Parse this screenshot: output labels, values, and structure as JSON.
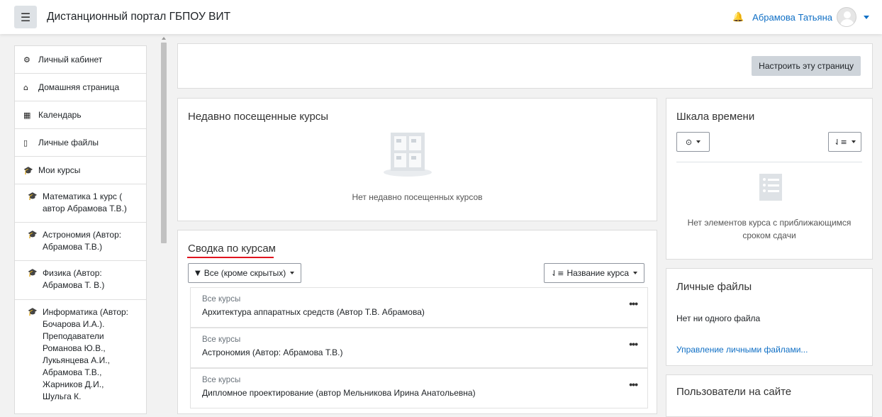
{
  "header": {
    "menu_icon": "hamburger-icon",
    "site_title": "Дистанционный портал ГБПОУ ВИТ",
    "username": "Абрамова Татьяна"
  },
  "sidebar": {
    "items": [
      {
        "icon": "dashboard-icon",
        "label": "Личный кабинет"
      },
      {
        "icon": "home-icon",
        "label": "Домашняя страница"
      },
      {
        "icon": "calendar-icon",
        "label": "Календарь"
      },
      {
        "icon": "file-icon",
        "label": "Личные файлы"
      },
      {
        "icon": "graduation-cap-icon",
        "label": "Мои курсы"
      }
    ],
    "courses": [
      "Математика 1 курс (\nавтор Абрамова Т.В.)",
      "Астрономия (Автор:\nАбрамова Т.В.)",
      "Физика (Автор:\nАбрамова Т. В.)",
      "Информатика (Автор:\nБочарова И.А.).\nПреподаватели\nРоманова Ю.В.,\nЛукьянцева А.И.,\nАбрамова Т.В.,\nЖарников Д.И.,\nШульга К."
    ]
  },
  "page": {
    "customize_button": "Настроить эту страницу"
  },
  "recent_courses": {
    "title": "Недавно посещенные курсы",
    "empty_text": "Нет недавно посещенных курсов"
  },
  "course_overview": {
    "title": "Сводка по курсам",
    "filter_label": "Все (кроме скрытых)",
    "sort_label": "Название курса",
    "courses": [
      {
        "category": "Все курсы",
        "name": "Архитектура аппаратных средств (Автор Т.В. Абрамова)"
      },
      {
        "category": "Все курсы",
        "name": "Астрономия (Автор: Абрамова Т.В.)"
      },
      {
        "category": "Все курсы",
        "name": "Дипломное проектирование (автор Мельникова Ирина Анатольевна)"
      }
    ],
    "menu_glyph": "•••"
  },
  "timeline": {
    "title": "Шкала времени",
    "empty_text": "Нет элементов курса с приближающимся сроком сдачи"
  },
  "private_files": {
    "title": "Личные файлы",
    "empty_text": "Нет ни одного файла",
    "manage_link": "Управление личными файлами..."
  },
  "online_users": {
    "title": "Пользователи на сайте"
  },
  "colors": {
    "link": "#0f6fc5",
    "annotation_underline": "#e0141e"
  }
}
